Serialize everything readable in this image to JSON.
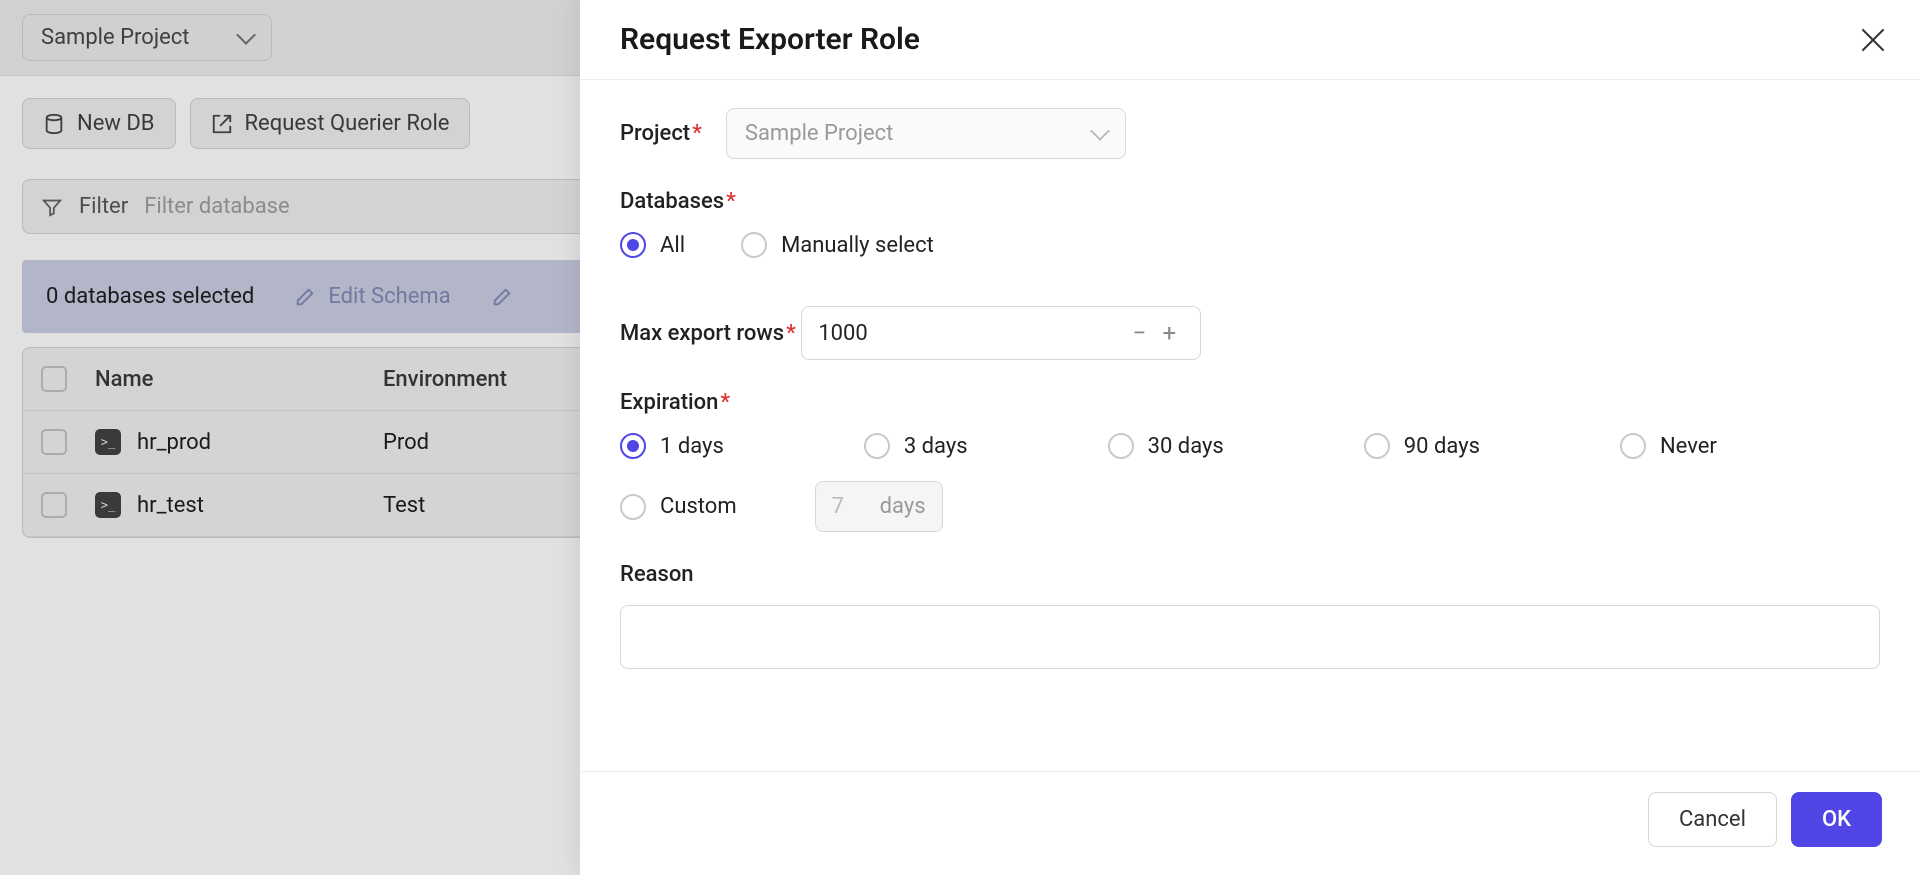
{
  "bg": {
    "project_name": "Sample Project",
    "toolbar": {
      "new_db": "New DB",
      "request_querier": "Request Querier Role"
    },
    "filter": {
      "label": "Filter",
      "placeholder": "Filter database"
    },
    "selected_bar": {
      "count_text": "0 databases selected",
      "edit_schema": "Edit Schema"
    },
    "table": {
      "headers": {
        "name": "Name",
        "env": "Environment"
      },
      "rows": [
        {
          "name": "hr_prod",
          "env": "Prod"
        },
        {
          "name": "hr_test",
          "env": "Test"
        }
      ]
    }
  },
  "modal": {
    "title": "Request Exporter Role",
    "fields": {
      "project": {
        "label": "Project",
        "value": "Sample Project"
      },
      "databases": {
        "label": "Databases",
        "options": {
          "all": "All",
          "manual": "Manually select"
        },
        "selected": "all"
      },
      "max_rows": {
        "label": "Max export rows",
        "value": "1000"
      },
      "expiration": {
        "label": "Expiration",
        "options": {
          "d1": "1 days",
          "d3": "3 days",
          "d30": "30 days",
          "d90": "90 days",
          "never": "Never",
          "custom": "Custom"
        },
        "selected": "d1",
        "custom_value": "7",
        "custom_unit": "days"
      },
      "reason": {
        "label": "Reason",
        "value": ""
      }
    },
    "footer": {
      "cancel": "Cancel",
      "ok": "OK"
    }
  }
}
